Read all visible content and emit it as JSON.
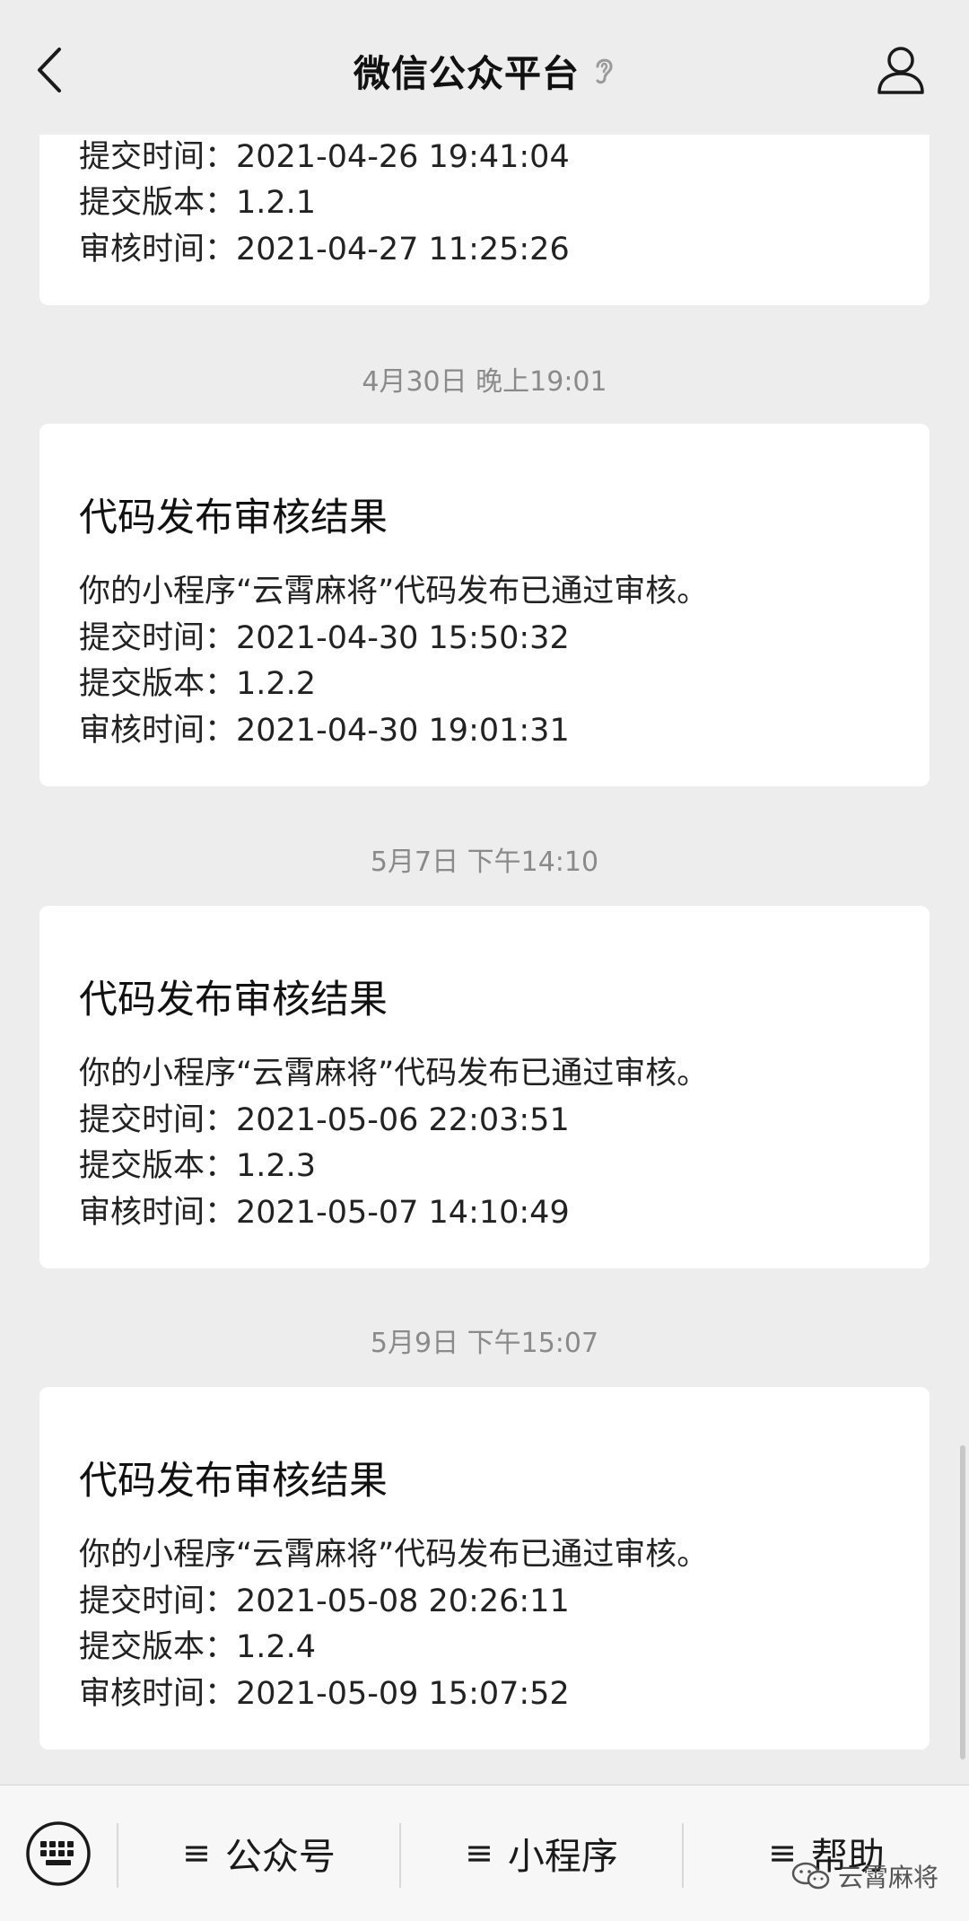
{
  "header": {
    "title": "微信公众平台",
    "back_icon": "chevron-left-icon",
    "ear_icon": "ear-icon",
    "profile_icon": "person-icon"
  },
  "messages": [
    {
      "lines": [
        "提交时间：2021-04-26 19:41:04",
        "提交版本：1.2.1",
        "审核时间：2021-04-27 11:25:26"
      ]
    },
    {
      "timestamp": "4月30日 晚上19:01",
      "title": "代码发布审核结果",
      "lines": [
        "你的小程序“云霄麻将”代码发布已通过审核。",
        "提交时间：2021-04-30 15:50:32",
        "提交版本：1.2.2",
        "审核时间：2021-04-30 19:01:31"
      ]
    },
    {
      "timestamp": "5月7日 下午14:10",
      "title": "代码发布审核结果",
      "lines": [
        "你的小程序“云霄麻将”代码发布已通过审核。",
        "提交时间：2021-05-06 22:03:51",
        "提交版本：1.2.3",
        "审核时间：2021-05-07 14:10:49"
      ]
    },
    {
      "timestamp": "5月9日 下午15:07",
      "title": "代码发布审核结果",
      "lines": [
        "你的小程序“云霄麻将”代码发布已通过审核。",
        "提交时间：2021-05-08 20:26:11",
        "提交版本：1.2.4",
        "审核时间：2021-05-09 15:07:52"
      ]
    }
  ],
  "bottom_menu": {
    "keyboard_icon": "keyboard-icon",
    "menu_glyph": "≡",
    "items": [
      "公众号",
      "小程序",
      "帮助"
    ]
  },
  "watermark": {
    "text": "云霄麻将",
    "icon": "wechat-icon"
  }
}
